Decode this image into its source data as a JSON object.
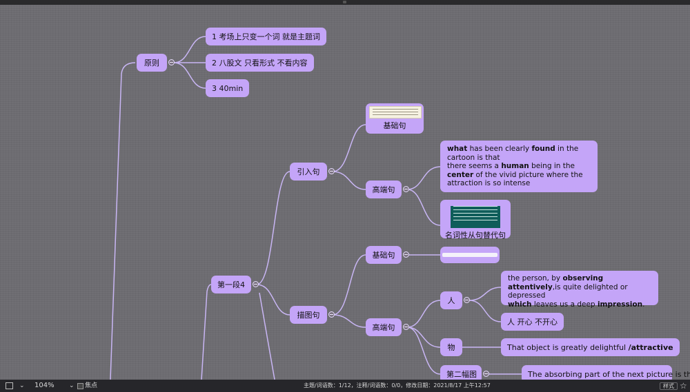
{
  "nodes": {
    "principle": "原则",
    "principle_1": "1 考场上只变一个词 就是主题词",
    "principle_2": "2 八股文 只看形式 不看内容",
    "principle_3": "3 40min",
    "para1": "第一段4",
    "intro": "引入句",
    "intro_basic": "基础句",
    "intro_advanced": "高端句",
    "intro_adv_text": {
      "s1": "what",
      "s2": " has been clearly ",
      "s3": "found",
      "s4": " in the cartoon is that",
      "s5": "there seems a ",
      "s6": "human",
      "s7": " being in the ",
      "s8": "center",
      "s9": " of the  vivid picture  where the attraction is so intense"
    },
    "noun_clause": "名词性从句替代句",
    "describe": "描图句",
    "describe_basic": "基础句",
    "describe_advanced": "高端句",
    "person": "人",
    "person_text": {
      "s1": "the person, by ",
      "s2": "observing attentively",
      "s3": ",is quite delighted or depressed",
      "s4": "which",
      "s5": " leaves us a deep ",
      "s6": "impression",
      "s7": "."
    },
    "person_mood": "人 开心 不开心",
    "object": "物",
    "object_text": {
      "s1": "That object is greatly delightful ",
      "s2": "/attractive"
    },
    "second_picture": "第二幅图",
    "second_picture_text": "The absorbing part of the next picture is that"
  },
  "statusbar": {
    "zoom": "104%",
    "focus_label": "焦点",
    "info": "主题/词语数：1/12，注释/词语数：0/0，修改日期：2021/8/17 上午12:57",
    "style_button": "样式",
    "star_icon": "star-icon"
  },
  "colors": {
    "node_fill": "#c4a5f8",
    "line": "#c9b6f5",
    "background": "#6d6c71",
    "statusbar": "#26262a"
  }
}
